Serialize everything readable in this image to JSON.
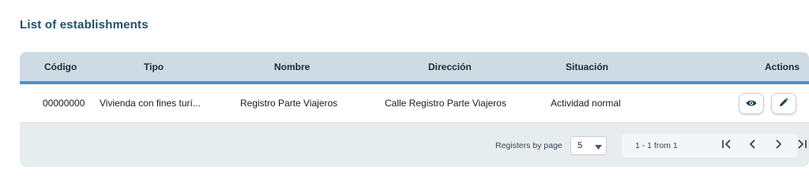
{
  "page": {
    "title": "List of establishments"
  },
  "table": {
    "headers": {
      "codigo": "Código",
      "tipo": "Tipo",
      "nombre": "Nombre",
      "direccion": "Dirección",
      "situacion": "Situación",
      "actions": "Actions"
    },
    "rows": [
      {
        "codigo": "00000000",
        "tipo": "Vivienda con fines turí...",
        "nombre": "Registro Parte Viajeros",
        "direccion": "Calle Registro Parte Viajeros",
        "situacion": "Actividad normal",
        "actions": [
          "eye-icon",
          "pencil-icon"
        ]
      }
    ]
  },
  "pagination": {
    "registers_label": "Registers by page",
    "page_size": "5",
    "range_text": "1 - 1 from 1",
    "controls": [
      "first-page-icon",
      "prev-page-icon",
      "next-page-icon",
      "last-page-icon"
    ]
  },
  "colors": {
    "title": "#1f4e6e",
    "header_bg": "#cfdbe4",
    "header_accent": "#4a93c9",
    "card_bg": "#e7ecef"
  }
}
